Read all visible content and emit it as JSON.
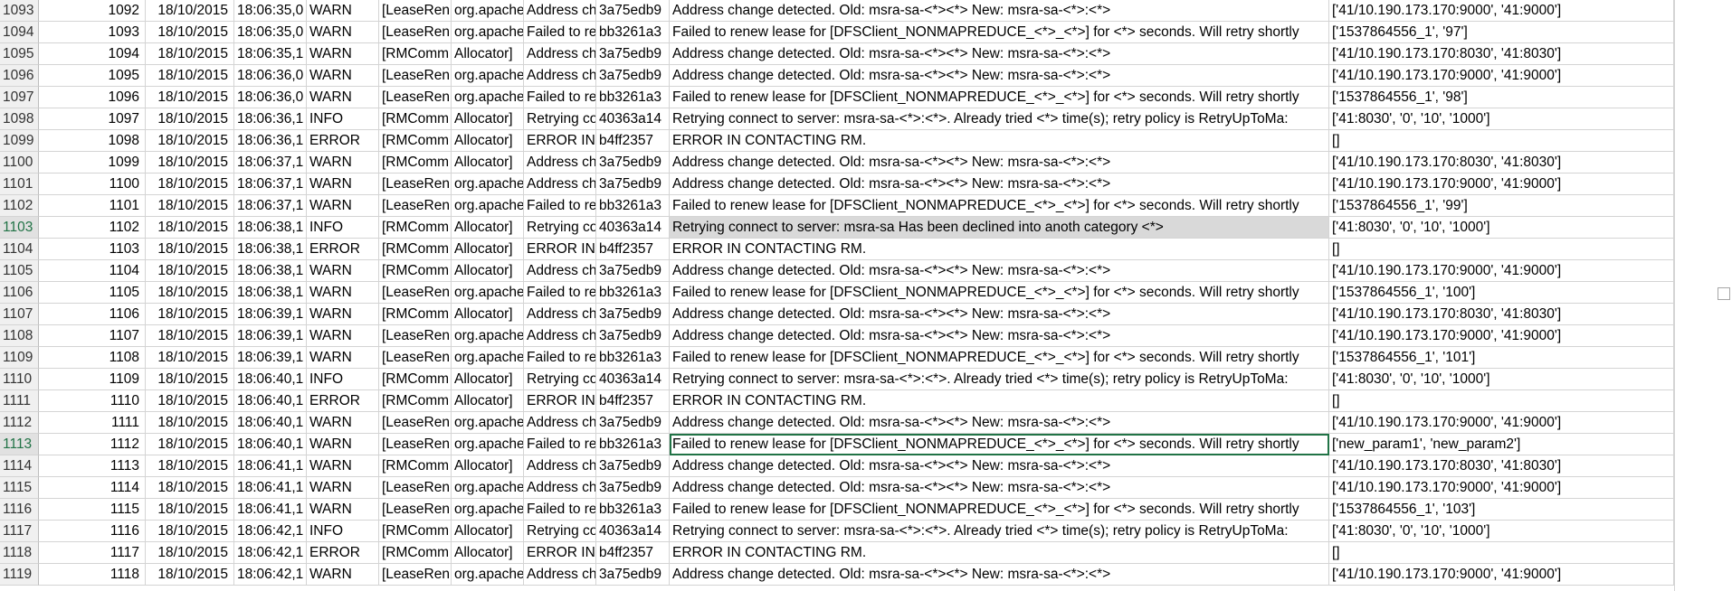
{
  "rows": [
    {
      "rownum": "1093",
      "id": "1092",
      "date": "18/10/2015",
      "time": "18:06:35,0",
      "level": "WARN",
      "thread": "[LeaseRen",
      "cls": "org.apache",
      "tmpl": "Address ch",
      "hash": "3a75edb9",
      "msg": "Address change detected. Old: msra-sa-<*><*> New: msra-sa-<*>:<*>",
      "params": "['41/10.190.173.170:9000', '41:9000']"
    },
    {
      "rownum": "1094",
      "id": "1093",
      "date": "18/10/2015",
      "time": "18:06:35,0",
      "level": "WARN",
      "thread": "[LeaseRen",
      "cls": "org.apache",
      "tmpl": "Failed to re",
      "hash": "bb3261a3",
      "msg": "Failed to renew lease for [DFSClient_NONMAPREDUCE_<*>_<*>] for <*> seconds. Will retry shortly",
      "params": "['1537864556_1', '97']"
    },
    {
      "rownum": "1095",
      "id": "1094",
      "date": "18/10/2015",
      "time": "18:06:35,1",
      "level": "WARN",
      "thread": "[RMComm",
      "cls": "Allocator]",
      "tmpl": "Address ch",
      "hash": "3a75edb9",
      "msg": "Address change detected. Old: msra-sa-<*><*> New: msra-sa-<*>:<*>",
      "params": "['41/10.190.173.170:8030', '41:8030']"
    },
    {
      "rownum": "1096",
      "id": "1095",
      "date": "18/10/2015",
      "time": "18:06:36,0",
      "level": "WARN",
      "thread": "[LeaseRen",
      "cls": "org.apache",
      "tmpl": "Address ch",
      "hash": "3a75edb9",
      "msg": "Address change detected. Old: msra-sa-<*><*> New: msra-sa-<*>:<*>",
      "params": "['41/10.190.173.170:9000', '41:9000']"
    },
    {
      "rownum": "1097",
      "id": "1096",
      "date": "18/10/2015",
      "time": "18:06:36,0",
      "level": "WARN",
      "thread": "[LeaseRen",
      "cls": "org.apache",
      "tmpl": "Failed to re",
      "hash": "bb3261a3",
      "msg": "Failed to renew lease for [DFSClient_NONMAPREDUCE_<*>_<*>] for <*> seconds. Will retry shortly",
      "params": "['1537864556_1', '98']"
    },
    {
      "rownum": "1098",
      "id": "1097",
      "date": "18/10/2015",
      "time": "18:06:36,1",
      "level": "INFO",
      "thread": "[RMComm",
      "cls": "Allocator]",
      "tmpl": "Retrying co",
      "hash": "40363a14",
      "msg": "Retrying connect to server: msra-sa-<*>:<*>. Already tried <*> time(s); retry policy is RetryUpToMa:",
      "params": "['41:8030', '0', '10', '1000']"
    },
    {
      "rownum": "1099",
      "id": "1098",
      "date": "18/10/2015",
      "time": "18:06:36,1",
      "level": "ERROR",
      "thread": "[RMComm",
      "cls": "Allocator]",
      "tmpl": "ERROR IN",
      "hash": "b4ff2357",
      "msg": "ERROR IN CONTACTING RM.",
      "params": "[]"
    },
    {
      "rownum": "1100",
      "id": "1099",
      "date": "18/10/2015",
      "time": "18:06:37,1",
      "level": "WARN",
      "thread": "[RMComm",
      "cls": "Allocator]",
      "tmpl": "Address ch",
      "hash": "3a75edb9",
      "msg": "Address change detected. Old: msra-sa-<*><*> New: msra-sa-<*>:<*>",
      "params": "['41/10.190.173.170:8030', '41:8030']"
    },
    {
      "rownum": "1101",
      "id": "1100",
      "date": "18/10/2015",
      "time": "18:06:37,1",
      "level": "WARN",
      "thread": "[LeaseRen",
      "cls": "org.apache",
      "tmpl": "Address ch",
      "hash": "3a75edb9",
      "msg": "Address change detected. Old: msra-sa-<*><*> New: msra-sa-<*>:<*>",
      "params": "['41/10.190.173.170:9000', '41:9000']"
    },
    {
      "rownum": "1102",
      "id": "1101",
      "date": "18/10/2015",
      "time": "18:06:37,1",
      "level": "WARN",
      "thread": "[LeaseRen",
      "cls": "org.apache",
      "tmpl": "Failed to re",
      "hash": "bb3261a3",
      "msg": "Failed to renew lease for [DFSClient_NONMAPREDUCE_<*>_<*>] for <*> seconds. Will retry shortly",
      "params": "['1537864556_1', '99']"
    },
    {
      "rownum": "1103",
      "id": "1102",
      "date": "18/10/2015",
      "time": "18:06:38,1",
      "level": "INFO",
      "thread": "[RMComm",
      "cls": "Allocator]",
      "tmpl": "Retrying co",
      "hash": "40363a14",
      "msg": "Retrying connect to server: msra-sa Has been declined into anoth category <*>",
      "params": "['41:8030', '0', '10', '1000']"
    },
    {
      "rownum": "1104",
      "id": "1103",
      "date": "18/10/2015",
      "time": "18:06:38,1",
      "level": "ERROR",
      "thread": "[RMComm",
      "cls": "Allocator]",
      "tmpl": "ERROR IN",
      "hash": "b4ff2357",
      "msg": "ERROR IN CONTACTING RM.",
      "params": "[]"
    },
    {
      "rownum": "1105",
      "id": "1104",
      "date": "18/10/2015",
      "time": "18:06:38,1",
      "level": "WARN",
      "thread": "[RMComm",
      "cls": "Allocator]",
      "tmpl": "Address ch",
      "hash": "3a75edb9",
      "msg": "Address change detected. Old: msra-sa-<*><*> New: msra-sa-<*>:<*>",
      "params": "['41/10.190.173.170:9000', '41:9000']"
    },
    {
      "rownum": "1106",
      "id": "1105",
      "date": "18/10/2015",
      "time": "18:06:38,1",
      "level": "WARN",
      "thread": "[LeaseRen",
      "cls": "org.apache",
      "tmpl": "Failed to re",
      "hash": "bb3261a3",
      "msg": "Failed to renew lease for [DFSClient_NONMAPREDUCE_<*>_<*>] for <*> seconds. Will retry shortly",
      "params": "['1537864556_1', '100']"
    },
    {
      "rownum": "1107",
      "id": "1106",
      "date": "18/10/2015",
      "time": "18:06:39,1",
      "level": "WARN",
      "thread": "[RMComm",
      "cls": "Allocator]",
      "tmpl": "Address ch",
      "hash": "3a75edb9",
      "msg": "Address change detected. Old: msra-sa-<*><*> New: msra-sa-<*>:<*>",
      "params": "['41/10.190.173.170:8030', '41:8030']"
    },
    {
      "rownum": "1108",
      "id": "1107",
      "date": "18/10/2015",
      "time": "18:06:39,1",
      "level": "WARN",
      "thread": "[LeaseRen",
      "cls": "org.apache",
      "tmpl": "Address ch",
      "hash": "3a75edb9",
      "msg": "Address change detected. Old: msra-sa-<*><*> New: msra-sa-<*>:<*>",
      "params": "['41/10.190.173.170:9000', '41:9000']"
    },
    {
      "rownum": "1109",
      "id": "1108",
      "date": "18/10/2015",
      "time": "18:06:39,1",
      "level": "WARN",
      "thread": "[LeaseRen",
      "cls": "org.apache",
      "tmpl": "Failed to re",
      "hash": "bb3261a3",
      "msg": "Failed to renew lease for [DFSClient_NONMAPREDUCE_<*>_<*>] for <*> seconds. Will retry shortly",
      "params": "['1537864556_1', '101']"
    },
    {
      "rownum": "1110",
      "id": "1109",
      "date": "18/10/2015",
      "time": "18:06:40,1",
      "level": "INFO",
      "thread": "[RMComm",
      "cls": "Allocator]",
      "tmpl": "Retrying co",
      "hash": "40363a14",
      "msg": "Retrying connect to server: msra-sa-<*>:<*>. Already tried <*> time(s); retry policy is RetryUpToMa:",
      "params": "['41:8030', '0', '10', '1000']"
    },
    {
      "rownum": "1111",
      "id": "1110",
      "date": "18/10/2015",
      "time": "18:06:40,1",
      "level": "ERROR",
      "thread": "[RMComm",
      "cls": "Allocator]",
      "tmpl": "ERROR IN",
      "hash": "b4ff2357",
      "msg": "ERROR IN CONTACTING RM.",
      "params": "[]"
    },
    {
      "rownum": "1112",
      "id": "1111",
      "date": "18/10/2015",
      "time": "18:06:40,1",
      "level": "WARN",
      "thread": "[LeaseRen",
      "cls": "org.apache",
      "tmpl": "Address ch",
      "hash": "3a75edb9",
      "msg": "Address change detected. Old: msra-sa-<*><*> New: msra-sa-<*>:<*>",
      "params": "['41/10.190.173.170:9000', '41:9000']"
    },
    {
      "rownum": "1113",
      "id": "1112",
      "date": "18/10/2015",
      "time": "18:06:40,1",
      "level": "WARN",
      "thread": "[LeaseRen",
      "cls": "org.apache",
      "tmpl": "Failed to re",
      "hash": "bb3261a3",
      "msg": "Failed to renew lease for [DFSClient_NONMAPREDUCE_<*>_<*>] for <*> seconds. Will retry shortly",
      "params": "['new_param1', 'new_param2']"
    },
    {
      "rownum": "1114",
      "id": "1113",
      "date": "18/10/2015",
      "time": "18:06:41,1",
      "level": "WARN",
      "thread": "[RMComm",
      "cls": "Allocator]",
      "tmpl": "Address ch",
      "hash": "3a75edb9",
      "msg": "Address change detected. Old: msra-sa-<*><*> New: msra-sa-<*>:<*>",
      "params": "['41/10.190.173.170:8030', '41:8030']"
    },
    {
      "rownum": "1115",
      "id": "1114",
      "date": "18/10/2015",
      "time": "18:06:41,1",
      "level": "WARN",
      "thread": "[LeaseRen",
      "cls": "org.apache",
      "tmpl": "Address ch",
      "hash": "3a75edb9",
      "msg": "Address change detected. Old: msra-sa-<*><*> New: msra-sa-<*>:<*>",
      "params": "['41/10.190.173.170:9000', '41:9000']"
    },
    {
      "rownum": "1116",
      "id": "1115",
      "date": "18/10/2015",
      "time": "18:06:41,1",
      "level": "WARN",
      "thread": "[LeaseRen",
      "cls": "org.apache",
      "tmpl": "Failed to re",
      "hash": "bb3261a3",
      "msg": "Failed to renew lease for [DFSClient_NONMAPREDUCE_<*>_<*>] for <*> seconds. Will retry shortly",
      "params": "['1537864556_1', '103']"
    },
    {
      "rownum": "1117",
      "id": "1116",
      "date": "18/10/2015",
      "time": "18:06:42,1",
      "level": "INFO",
      "thread": "[RMComm",
      "cls": "Allocator]",
      "tmpl": "Retrying co",
      "hash": "40363a14",
      "msg": "Retrying connect to server: msra-sa-<*>:<*>. Already tried <*> time(s); retry policy is RetryUpToMa:",
      "params": "['41:8030', '0', '10', '1000']"
    },
    {
      "rownum": "1118",
      "id": "1117",
      "date": "18/10/2015",
      "time": "18:06:42,1",
      "level": "ERROR",
      "thread": "[RMComm",
      "cls": "Allocator]",
      "tmpl": "ERROR IN",
      "hash": "b4ff2357",
      "msg": "ERROR IN CONTACTING RM.",
      "params": "[]"
    },
    {
      "rownum": "1119",
      "id": "1118",
      "date": "18/10/2015",
      "time": "18:06:42,1",
      "level": "WARN",
      "thread": "[LeaseRen",
      "cls": "org.apache",
      "tmpl": "Address ch",
      "hash": "3a75edb9",
      "msg": "Address change detected. Old: msra-sa-<*><*> New: msra-sa-<*>:<*>",
      "params": "['41/10.190.173.170:9000', '41:9000']"
    }
  ],
  "selection": {
    "active_row": "1113",
    "highlight_row": "1103"
  }
}
